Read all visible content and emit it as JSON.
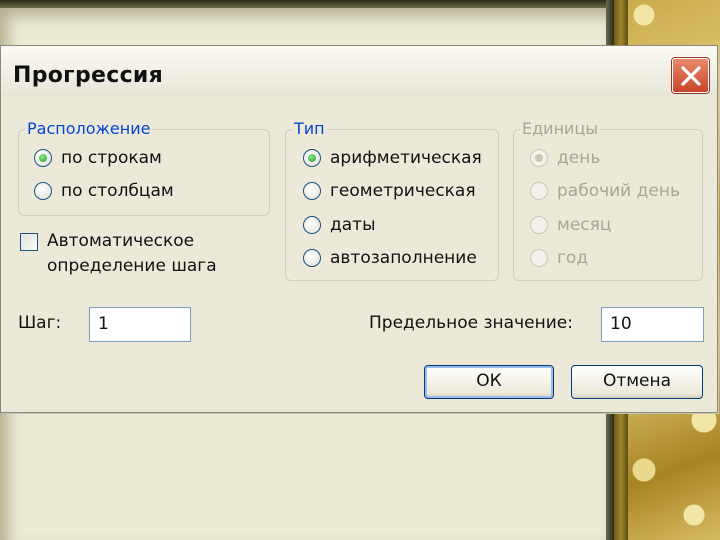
{
  "dialog": {
    "title": "Прогрессия",
    "close_icon": "close-icon"
  },
  "placement": {
    "legend": "Расположение",
    "options": [
      {
        "label": "по строкам",
        "checked": true
      },
      {
        "label": "по столбцам",
        "checked": false
      }
    ]
  },
  "type_group": {
    "legend": "Тип",
    "options": [
      {
        "label": "арифметическая",
        "checked": true
      },
      {
        "label": "геометрическая",
        "checked": false
      },
      {
        "label": "даты",
        "checked": false
      },
      {
        "label": "автозаполнение",
        "checked": false
      }
    ]
  },
  "units": {
    "legend": "Единицы",
    "disabled": true,
    "options": [
      {
        "label": "день",
        "checked": true
      },
      {
        "label": "рабочий день",
        "checked": false
      },
      {
        "label": "месяц",
        "checked": false
      },
      {
        "label": "год",
        "checked": false
      }
    ]
  },
  "auto_step": {
    "line1": "Автоматическое",
    "line2": "определение шага",
    "checked": false
  },
  "step": {
    "label": "Шаг:",
    "value": "1"
  },
  "limit": {
    "label": "Предельное значение:",
    "value": "10"
  },
  "buttons": {
    "ok": "ОК",
    "cancel": "Отмена"
  },
  "colors": {
    "legend_blue": "#0046d5",
    "dialog_bg": "#ece9d8",
    "close_red": "#c9442a"
  }
}
